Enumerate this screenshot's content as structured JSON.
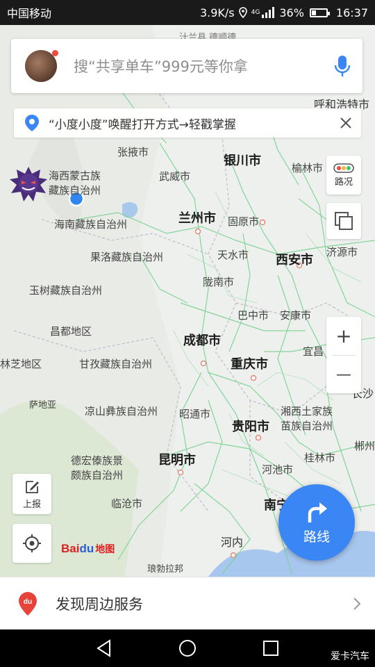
{
  "status_bar": {
    "carrier": "中国移动",
    "net_speed": "3.9K/s",
    "network": "4G",
    "battery": "36%",
    "time": "16:37"
  },
  "search": {
    "placeholder": "搜“共享单车”999元等你拿"
  },
  "tip": {
    "text": "“小度小度”唤醒打开方式→轻戳掌握"
  },
  "controls": {
    "traffic_label": "路况",
    "report_label": "上报",
    "route_label": "路线",
    "zoom_in": "+",
    "zoom_out": "—"
  },
  "logo": {
    "bai": "Bai",
    "du": "du",
    "map": "地图"
  },
  "bottom": {
    "nearby_label": "发现周边服务"
  },
  "map_labels": {
    "zhangye": "张掖市",
    "yinchuan": "银川市",
    "yulin": "榆林市",
    "wuwei": "武威市",
    "haixi_1": "海西蒙古族",
    "haixi_2": "藏族自治州",
    "hainan": "海南藏族自治州",
    "lanzhou": "兰州市",
    "guyuan": "固原市",
    "guoluo": "果洛藏族自治州",
    "tianshui": "天水市",
    "xian": "西安市",
    "jiyuan": "济源市",
    "yushu": "玉树藏族自治州",
    "longnan": "陇南市",
    "bazhong": "巴中市",
    "ankang": "安康市",
    "changdu": "昌都地区",
    "chengdu": "成都市",
    "yichang": "宜昌",
    "linzhi": "林芝地区",
    "ganzi": "甘孜藏族自治州",
    "chongqing": "重庆市",
    "changsha": "长沙",
    "sadiya": "萨地亚",
    "liangshan": "凉山彝族自治州",
    "zhaotong": "昭通市",
    "xiangxi_1": "湘西土家族",
    "xiangxi_2": "苗族自治州",
    "guiyang": "贵阳市",
    "chenzhou": "郴州",
    "dehong_1": "德宏傣族景",
    "dehong_2": "颇族自治州",
    "kunming": "昆明市",
    "hechi": "河池市",
    "guilin": "桂林市",
    "lincang": "临沧市",
    "nanning": "南宁",
    "hanoi": "河内",
    "luang": "琅勃拉邦",
    "top": "汁兰县 德顺德",
    "hohhot": "呼和浩特市"
  },
  "watermark": "爱卡汽车"
}
